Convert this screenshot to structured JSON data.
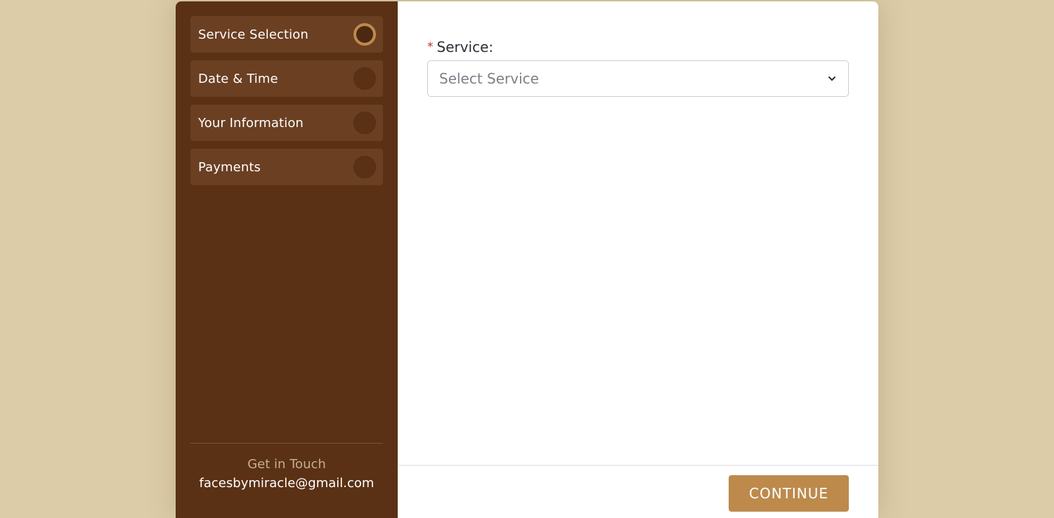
{
  "colors": {
    "page_background": "#dccca8",
    "sidebar": "#5a3114",
    "step_item": "#6b3f22",
    "accent": "#bd8a4c",
    "required": "#c0322a"
  },
  "sidebar": {
    "steps": [
      {
        "label": "Service Selection",
        "active": true
      },
      {
        "label": "Date & Time",
        "active": false
      },
      {
        "label": "Your Information",
        "active": false
      },
      {
        "label": "Payments",
        "active": false
      }
    ],
    "footer": {
      "title": "Get in Touch",
      "email": "facesbymiracle@gmail.com"
    }
  },
  "form": {
    "service": {
      "required_mark": "*",
      "label": "Service:",
      "placeholder": "Select Service",
      "icon": "chevron-down-icon"
    }
  },
  "actions": {
    "continue_label": "CONTINUE"
  }
}
